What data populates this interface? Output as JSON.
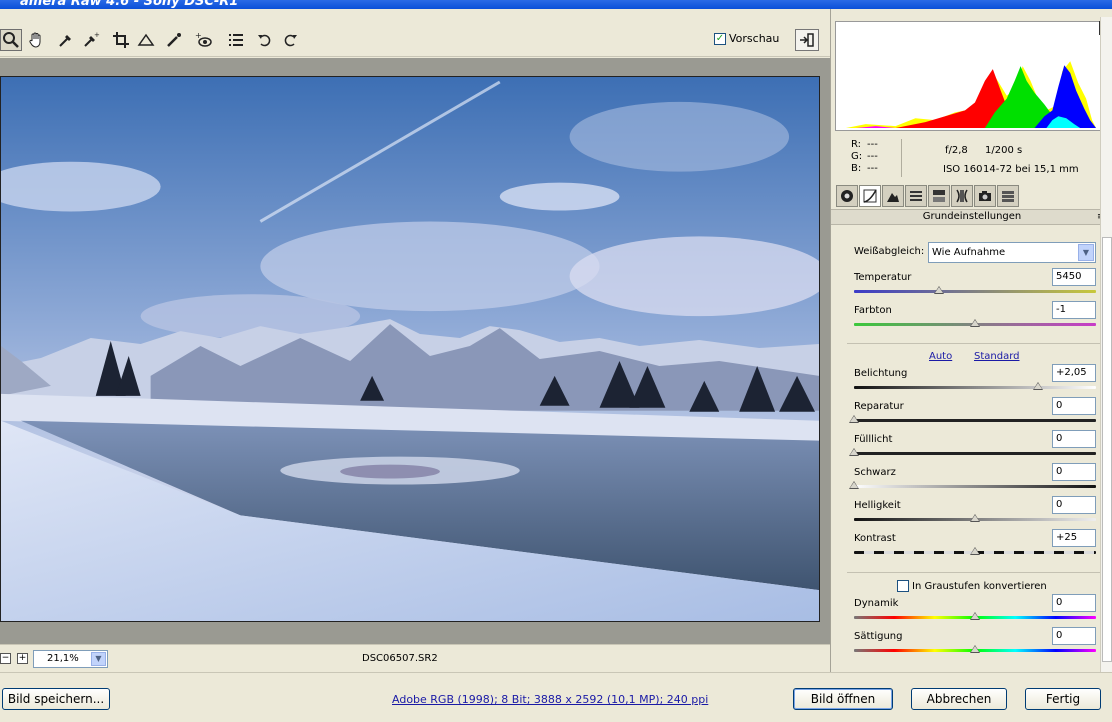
{
  "window": {
    "title": "amera Raw 4.6 - Sony DSC-R1"
  },
  "toolbar": {
    "tools": [
      {
        "name": "zoom-tool-icon"
      },
      {
        "name": "hand-tool-icon"
      },
      {
        "name": "white-balance-tool-icon"
      },
      {
        "name": "color-sampler-tool-icon"
      },
      {
        "name": "crop-tool-icon"
      },
      {
        "name": "straighten-tool-icon"
      },
      {
        "name": "spot-removal-tool-icon"
      },
      {
        "name": "red-eye-tool-icon"
      },
      {
        "name": "preferences-icon"
      },
      {
        "name": "rotate-left-icon"
      },
      {
        "name": "rotate-right-icon"
      }
    ],
    "preview_label": "Vorschau",
    "preview_checked": true
  },
  "image": {
    "filename": "DSC06507.SR2"
  },
  "zoom": {
    "value": "21,1%",
    "minus": "−",
    "plus": "+"
  },
  "info": {
    "r_label": "R:",
    "r_value": "---",
    "g_label": "G:",
    "g_value": "---",
    "b_label": "B:",
    "b_value": "---",
    "aperture": "f/2,8",
    "shutter": "1/200 s",
    "iso": "ISO 160",
    "lens": "14-72 bei 15,1 mm"
  },
  "panel": {
    "section_title": "Grundeinstellungen",
    "white_balance_label": "Weißabgleich:",
    "white_balance_value": "Wie Aufnahme",
    "auto_label": "Auto",
    "standard_label": "Standard",
    "grayscale_label": "In Graustufen konvertieren",
    "sliders": [
      {
        "label": "Temperatur",
        "value": "5450",
        "position": 0.35
      },
      {
        "label": "Farbton",
        "value": "-1",
        "position": 0.5
      },
      {
        "label": "Belichtung",
        "value": "+2,05",
        "position": 0.76
      },
      {
        "label": "Reparatur",
        "value": "0",
        "position": 0.0
      },
      {
        "label": "Fülllicht",
        "value": "0",
        "position": 0.0
      },
      {
        "label": "Schwarz",
        "value": "0",
        "position": 0.0
      },
      {
        "label": "Helligkeit",
        "value": "0",
        "position": 0.5
      },
      {
        "label": "Kontrast",
        "value": "+25",
        "position": 0.5
      },
      {
        "label": "Dynamik",
        "value": "0",
        "position": 0.5
      },
      {
        "label": "Sättigung",
        "value": "0",
        "position": 0.5
      }
    ]
  },
  "footer": {
    "save_label": "Bild speichern...",
    "workflow_text": "Adobe RGB (1998); 8 Bit; 3888 x 2592 (10,1 MP); 240 ppi",
    "open_label": "Bild öffnen",
    "cancel_label": "Abbrechen",
    "done_label": "Fertig"
  },
  "colors": {
    "temperature_track": [
      "#3b3bc8",
      "#c8c83b"
    ],
    "tint_track": [
      "#3bc83b",
      "#c83bc8"
    ]
  }
}
